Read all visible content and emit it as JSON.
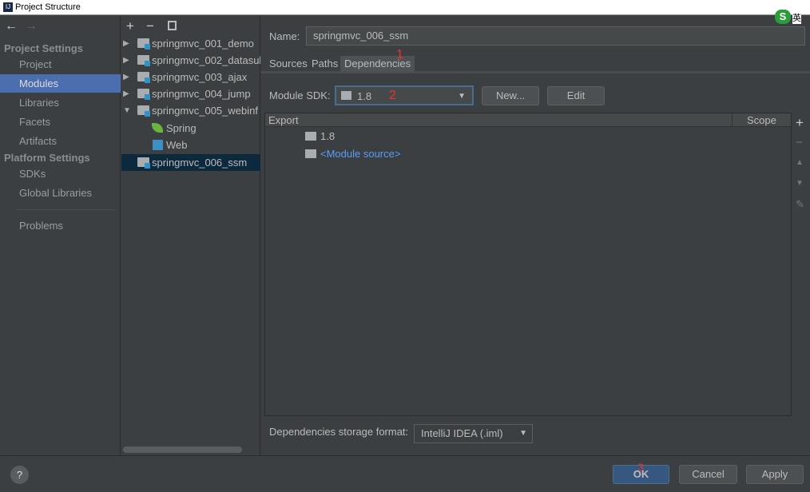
{
  "window": {
    "title": "Project Structure"
  },
  "ime": {
    "label": "英"
  },
  "sidebar": {
    "project_settings": "Project Settings",
    "platform_settings": "Platform Settings",
    "items": [
      {
        "label": "Project"
      },
      {
        "label": "Modules",
        "selected": true
      },
      {
        "label": "Libraries"
      },
      {
        "label": "Facets"
      },
      {
        "label": "Artifacts"
      }
    ],
    "platform_items": [
      {
        "label": "SDKs"
      },
      {
        "label": "Global Libraries"
      }
    ],
    "problems": "Problems"
  },
  "tree": {
    "nodes": [
      {
        "label": "springmvc_001_demo"
      },
      {
        "label": "springmvc_002_datasub"
      },
      {
        "label": "springmvc_003_ajax"
      },
      {
        "label": "springmvc_004_jump"
      },
      {
        "label": "springmvc_005_webinf"
      },
      {
        "label": "Spring"
      },
      {
        "label": "Web"
      },
      {
        "label": "springmvc_006_ssm",
        "selected": true
      }
    ]
  },
  "main": {
    "name_label": "Name:",
    "name_value": "springmvc_006_ssm",
    "tabs": [
      {
        "label": "Sources"
      },
      {
        "label": "Paths"
      },
      {
        "label": "Dependencies",
        "selected": true
      }
    ],
    "sdk_label": "Module SDK:",
    "sdk_value": "1.8",
    "new_button": "New...",
    "edit_button": "Edit",
    "table": {
      "headers": [
        "Export",
        "Scope"
      ],
      "rows": [
        {
          "label": "1.8"
        },
        {
          "label": "<Module source>"
        }
      ]
    },
    "storage_label": "Dependencies storage format:",
    "storage_value": "IntelliJ IDEA (.iml)"
  },
  "annotations": [
    "1",
    "2",
    "3"
  ],
  "footer": {
    "help": "?",
    "ok": "OK",
    "cancel": "Cancel",
    "apply": "Apply"
  }
}
